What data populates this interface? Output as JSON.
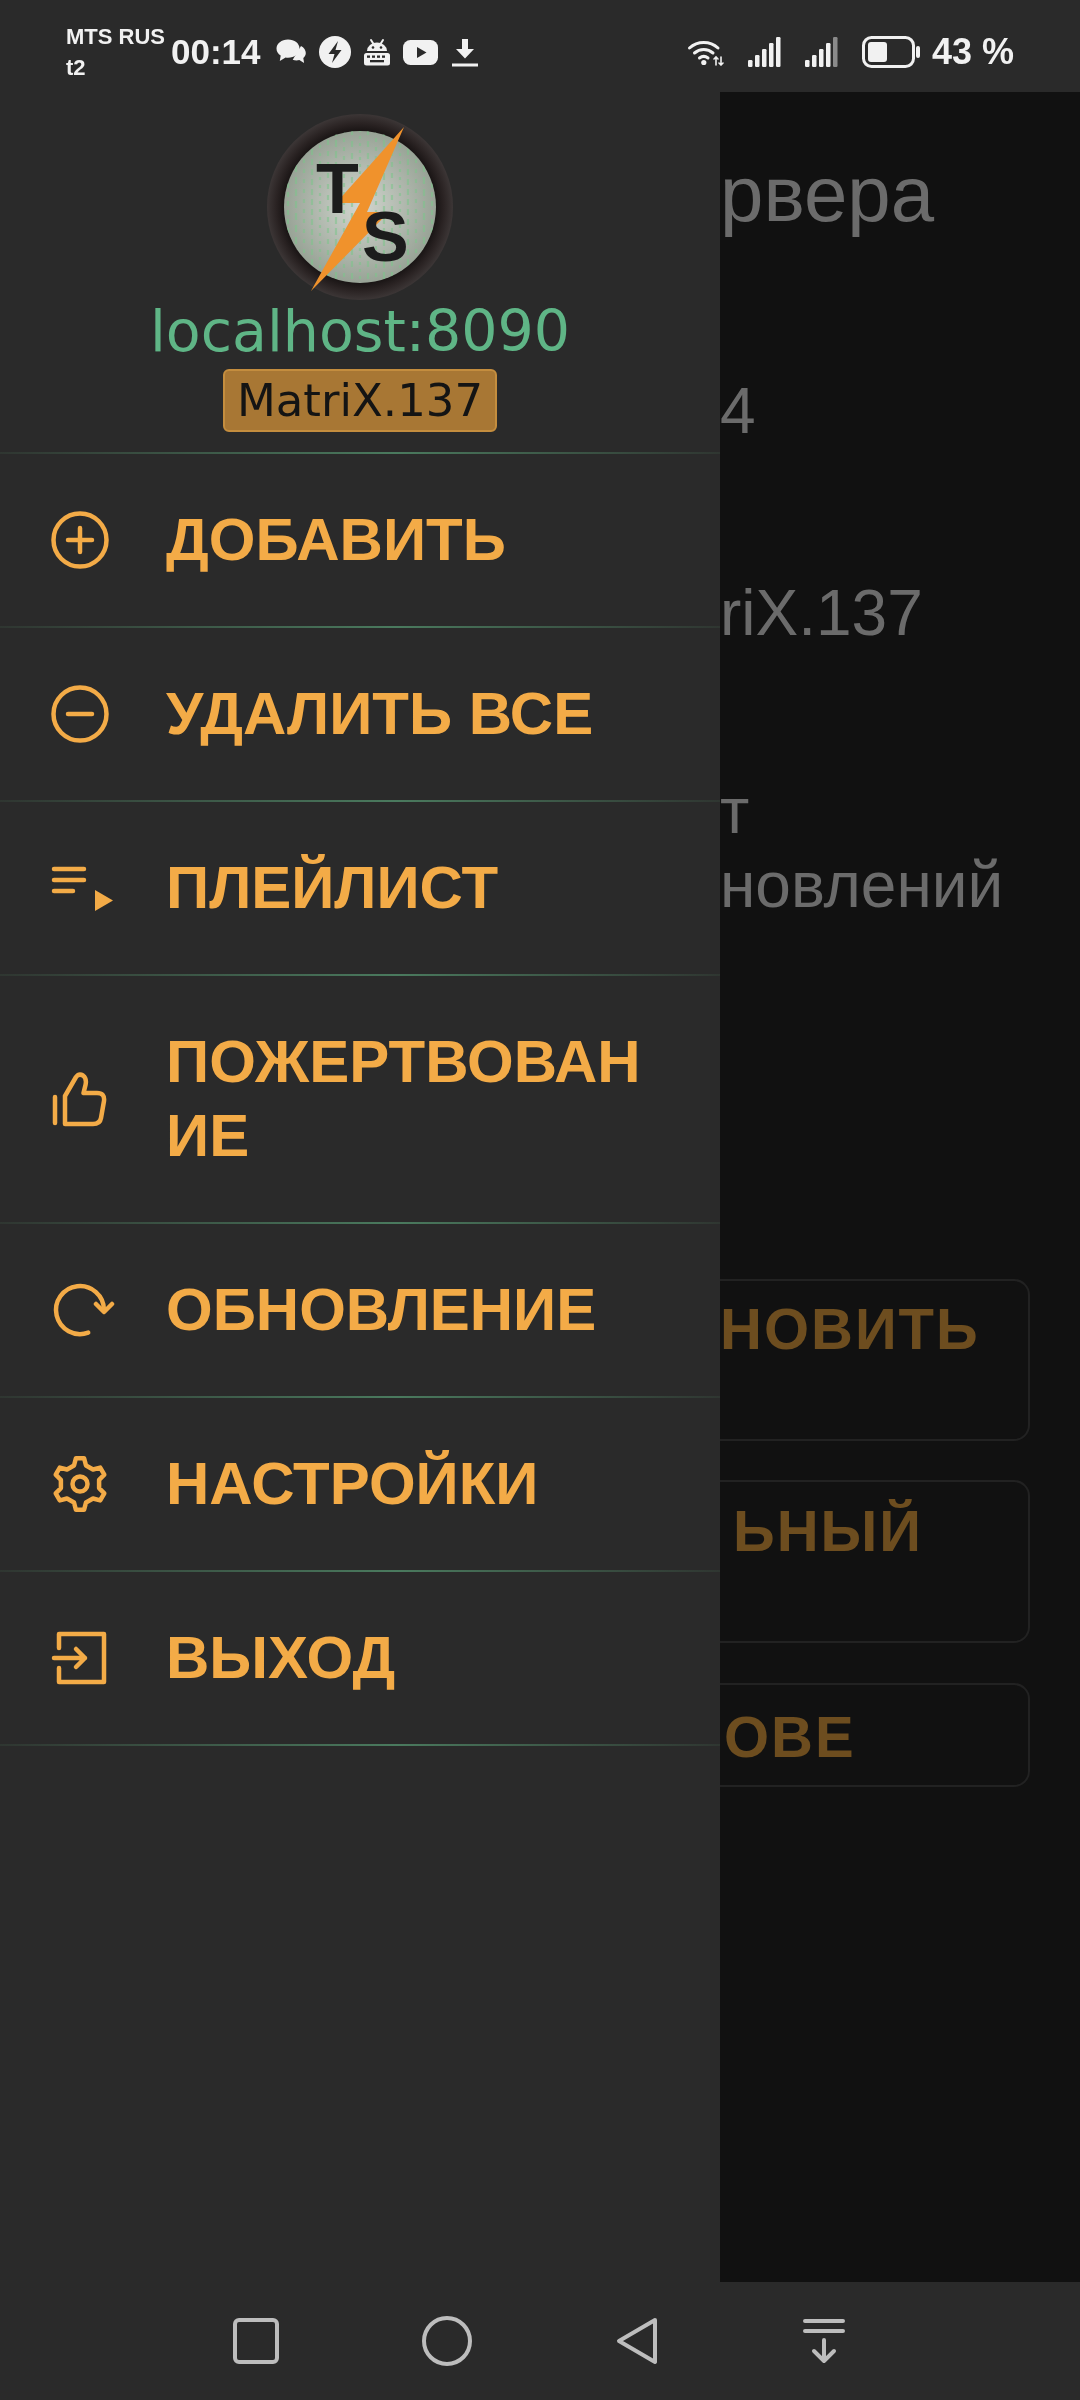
{
  "status_bar": {
    "carrier": [
      "MTS RUS",
      "t2"
    ],
    "time": "00:14",
    "battery": "43 %"
  },
  "drawer": {
    "header": {
      "logo_letters": [
        "T",
        "S"
      ],
      "server_address": "localhost:8090",
      "server_name": "MatriX.137"
    },
    "items": [
      {
        "label": "ДОБАВИТЬ"
      },
      {
        "label": "УДАЛИТЬ ВСЕ"
      },
      {
        "label": "ПЛЕЙЛИСТ"
      },
      {
        "label": "ПОЖЕРТВОВАНИЕ"
      },
      {
        "label": "ОБНОВЛЕНИЕ"
      },
      {
        "label": "НАСТРОЙКИ"
      },
      {
        "label": "ВЫХОД"
      }
    ]
  },
  "background_screen": {
    "title": "рвера",
    "texts": [
      "4",
      "riX.137",
      "т",
      "новлений"
    ],
    "buttons": [
      "НОВИТЬ",
      "ЬНЫЙ",
      "ОВЕ"
    ]
  }
}
